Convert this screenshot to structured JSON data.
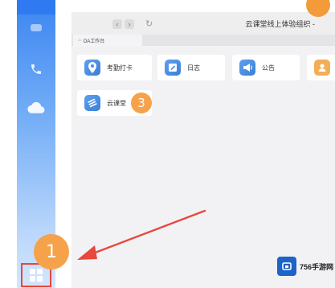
{
  "window": {
    "org_name": "云课堂线上体验组织 -",
    "nav_back": "‹",
    "nav_forward": "›",
    "refresh": "↻"
  },
  "tabs": [
    {
      "label": "OA工作台",
      "icon": "home-icon"
    }
  ],
  "apps": [
    {
      "label": "考勤打卡",
      "icon": "location-pin-icon"
    },
    {
      "label": "日志",
      "icon": "log-edit-icon"
    },
    {
      "label": "公告",
      "icon": "megaphone-icon"
    },
    {
      "label": "云课堂",
      "icon": "cloud-classroom-icon"
    }
  ],
  "badges": {
    "step1": "1",
    "step3": "3"
  },
  "sidebar": {
    "icons": [
      "phone-icon",
      "cloud-icon",
      "grid-apps-icon"
    ]
  },
  "watermark": {
    "text": "756手游网"
  },
  "colors": {
    "sidebar_blue": "#3b86f1",
    "badge_orange": "#f5a24b",
    "arrow_red": "#e8473b",
    "app_icon_blue": "#4a8ee6"
  }
}
